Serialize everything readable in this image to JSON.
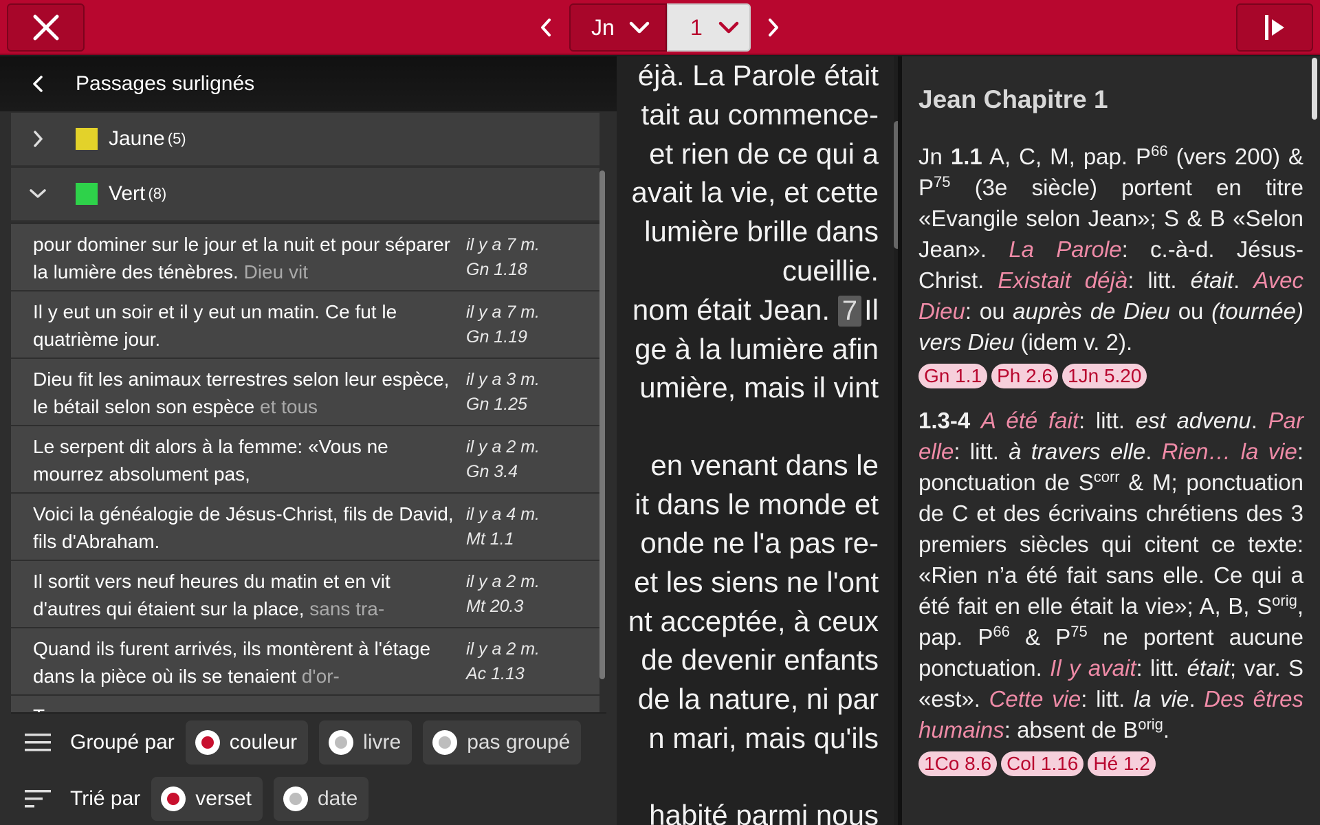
{
  "topbar": {
    "book": "Jn",
    "chapter": "1",
    "accent": "#b8072f"
  },
  "panel": {
    "title": "Passages surlignés",
    "groups": [
      {
        "name": "Jaune",
        "count": "(5)",
        "color": "#e3d22a",
        "expanded": false
      },
      {
        "name": "Vert",
        "count": "(8)",
        "color": "#2ed24a",
        "expanded": true
      }
    ],
    "items": [
      {
        "text": "pour dominer sur le jour et la nuit et pour séparer la lumière des ténèbres. ",
        "fade": "Dieu vit",
        "time": "il y a 7 m.",
        "ref": "Gn 1.18"
      },
      {
        "text": "Il y eut un soir et il y eut un matin. Ce fut le quatrième jour.",
        "fade": "",
        "time": "il y a 7 m.",
        "ref": "Gn 1.19"
      },
      {
        "text": "Dieu fit les animaux terrestres selon leur espèce, le bétail selon son espèce ",
        "fade": "et tous",
        "time": "il y a 3 m.",
        "ref": "Gn 1.25"
      },
      {
        "text": "Le serpent dit alors à la femme: «Vous ne mourrez absolument pas,",
        "fade": "",
        "time": "il y a 2 m.",
        "ref": "Gn 3.4"
      },
      {
        "text": "Voici la généalogie de Jésus-Christ, fils de David, fils d'Abraham.",
        "fade": "",
        "time": "il y a 4 m.",
        "ref": "Mt 1.1"
      },
      {
        "text": "Il sortit vers neuf heures du matin et en vit d'autres qui étaient sur la place, ",
        "fade": "sans tra-",
        "time": "il y a 2 m.",
        "ref": "Mt 20.3"
      },
      {
        "text": "Quand ils furent arrivés, ils montèrent à l'étage dans la pièce où ils se tenaient ",
        "fade": "d'or-",
        "time": "il y a 2 m.",
        "ref": "Ac 1.13"
      },
      {
        "text": "T",
        "fade": "",
        "time": "",
        "ref": ""
      }
    ],
    "group_by": {
      "label": "Groupé par",
      "options": [
        {
          "label": "couleur",
          "selected": true
        },
        {
          "label": "livre",
          "selected": false
        },
        {
          "label": "pas groupé",
          "selected": false
        }
      ]
    },
    "sort_by": {
      "label": "Trié par",
      "options": [
        {
          "label": "verset",
          "selected": true
        },
        {
          "label": "date",
          "selected": false
        }
      ]
    }
  },
  "bible_text": {
    "lines": [
      "éjà. La Parole était",
      "tait au commence-",
      "et rien de ce qui a",
      "avait la vie, et cette",
      "lumière brille dans",
      "cueillie.",
      "",
      "ge à la lumière afin",
      "umière, mais il vint",
      "",
      "en venant dans le",
      "it dans le monde et",
      "onde ne l'a pas re-",
      "et les siens ne l'ont",
      "nt acceptée, à ceux",
      "de devenir enfants",
      "de la nature, ni par",
      "n mari, mais qu'ils",
      "",
      "habité parmi nous"
    ],
    "verse_line": {
      "before": "nom était Jean. ",
      "verse": "7",
      "after": "Il"
    }
  },
  "notes": {
    "title": "Jean Chapitre 1",
    "tags1": [
      "Gn 1.1",
      "Ph 2.6",
      "1Jn 5.20"
    ],
    "tags2": [
      "1Co 8.6",
      "Col 1.16",
      "Hé 1.2"
    ]
  }
}
